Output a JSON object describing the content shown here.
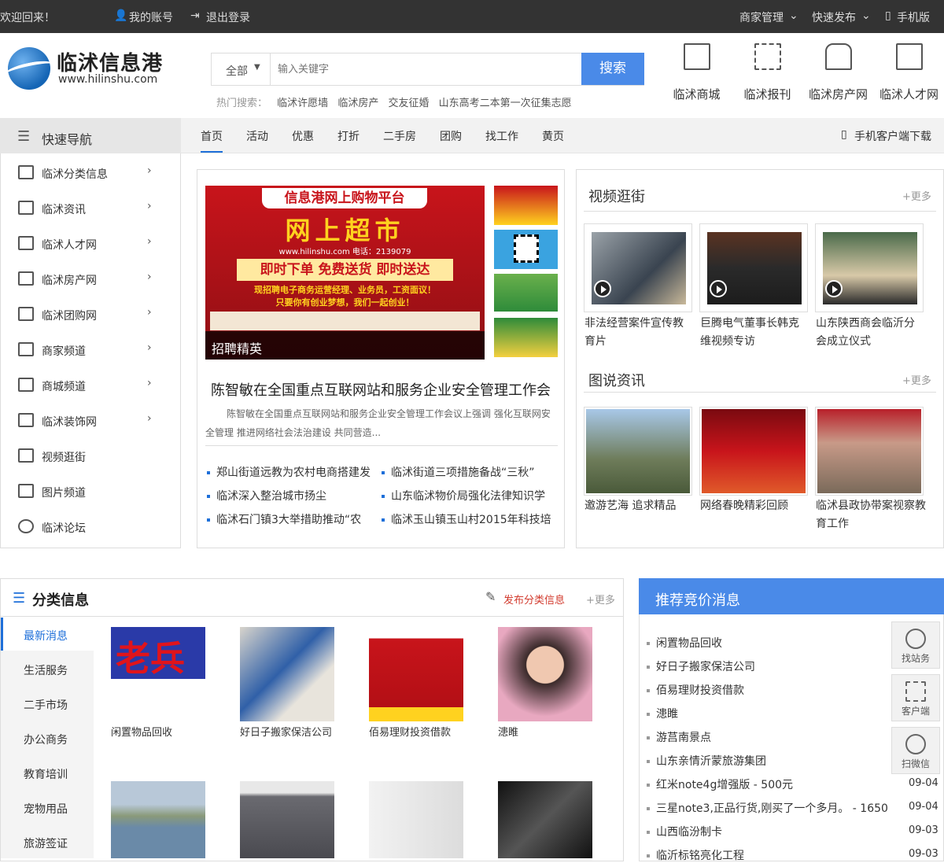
{
  "topbar": {
    "welcome": "欢迎回来！",
    "account": "我的账号",
    "logout": "退出登录",
    "merchant": "商家管理",
    "quick_post": "快速发布",
    "mobile": "手机版"
  },
  "logo": {
    "name": "临沭信息港",
    "url": "www.hilinshu.com"
  },
  "search": {
    "category": "全部",
    "placeholder": "输入关键字",
    "button": "搜索",
    "hot_label": "热门搜索：",
    "hot": [
      "临沭许愿墙",
      "临沭房产",
      "交友征婚",
      "山东高考二本第一次征集志愿"
    ]
  },
  "channels": [
    "临沭商城",
    "临沭报刊",
    "临沭房产网",
    "临沭人才网"
  ],
  "nav": {
    "quick": "快速导航",
    "items": [
      "首页",
      "活动",
      "优惠",
      "打折",
      "二手房",
      "团购",
      "找工作",
      "黄页"
    ],
    "app": "手机客户端下载"
  },
  "sidebar": [
    "临沭分类信息",
    "临沭资讯",
    "临沭人才网",
    "临沭房产网",
    "临沭团购网",
    "商家频道",
    "商城频道",
    "临沭装饰网",
    "视频逛街",
    "图片频道",
    "临沭论坛"
  ],
  "banner": {
    "title": "信息港网上购物平台",
    "big": "网上超市",
    "site": "www.hilinshu.com  电话：2139079",
    "slogan": "即时下单 免费送货 即时送达",
    "recruit": "现招聘电子商务运营经理、业务员，工资面议！",
    "recruit2": "只要你有创业梦想，我们一起创业！",
    "caption": "招聘精英"
  },
  "news": {
    "headline": "陈智敏在全国重点互联网站和服务企业安全管理工作会",
    "summary": "陈智敏在全国重点互联网站和服务企业安全管理工作会议上强调 强化互联网安全管理 推进网络社会法治建设 共同营造...",
    "items": [
      "郑山街道远教为农村电商搭建发",
      "临沭街道三项措施备战“三秋”",
      "临沭深入整治城市扬尘",
      "山东临沭物价局强化法律知识学",
      "临沭石门镇3大举措助推动“农",
      "临沭玉山镇玉山村2015年科技培"
    ]
  },
  "video": {
    "title": "视频逛街",
    "more": "+更多",
    "items": [
      "非法经营案件宣传教育片",
      "巨腾电气董事长韩克维视频专访",
      "山东陕西商会临沂分会成立仪式"
    ]
  },
  "photo": {
    "title": "图说资讯",
    "more": "+更多",
    "items": [
      "邀游艺海 追求精品",
      "网络春晚精彩回顾",
      "临沭县政协带案视察教育工作"
    ]
  },
  "classified": {
    "title": "分类信息",
    "post": "发布分类信息",
    "more": "+更多",
    "tabs": [
      "最新消息",
      "生活服务",
      "二手市场",
      "办公商务",
      "教育培训",
      "宠物用品",
      "旅游签证"
    ],
    "items": [
      "闲置物品回收",
      "好日子搬家保洁公司",
      "佰易理财投资借款",
      "漶睢"
    ]
  },
  "recommend": {
    "title": "推荐竞价消息",
    "items": [
      {
        "text": "闲置物品回收",
        "date": ""
      },
      {
        "text": "好日子搬家保洁公司",
        "date": ""
      },
      {
        "text": "佰易理财投资借款",
        "date": ""
      },
      {
        "text": "漶睢",
        "date": ""
      },
      {
        "text": "游莒南景点",
        "date": ""
      },
      {
        "text": "山东亲情沂蒙旅游集团",
        "date": ""
      },
      {
        "text": "红米note4g增强版 - 500元",
        "date": "09-04"
      },
      {
        "text": "三星note3,正品行货,刚买了一个多月。 - 1650",
        "date": "09-04"
      },
      {
        "text": "山西临汾制卡",
        "date": "09-03"
      },
      {
        "text": "临沂标铭亮化工程",
        "date": "09-03"
      }
    ]
  },
  "floatbar": [
    "找站务",
    "客户端",
    "扫微信"
  ],
  "colors": {
    "accent": "#4a8ae8",
    "topbar": "#333333",
    "nav_blue": "#1e6fd9",
    "banner_red": "#b3151c"
  }
}
